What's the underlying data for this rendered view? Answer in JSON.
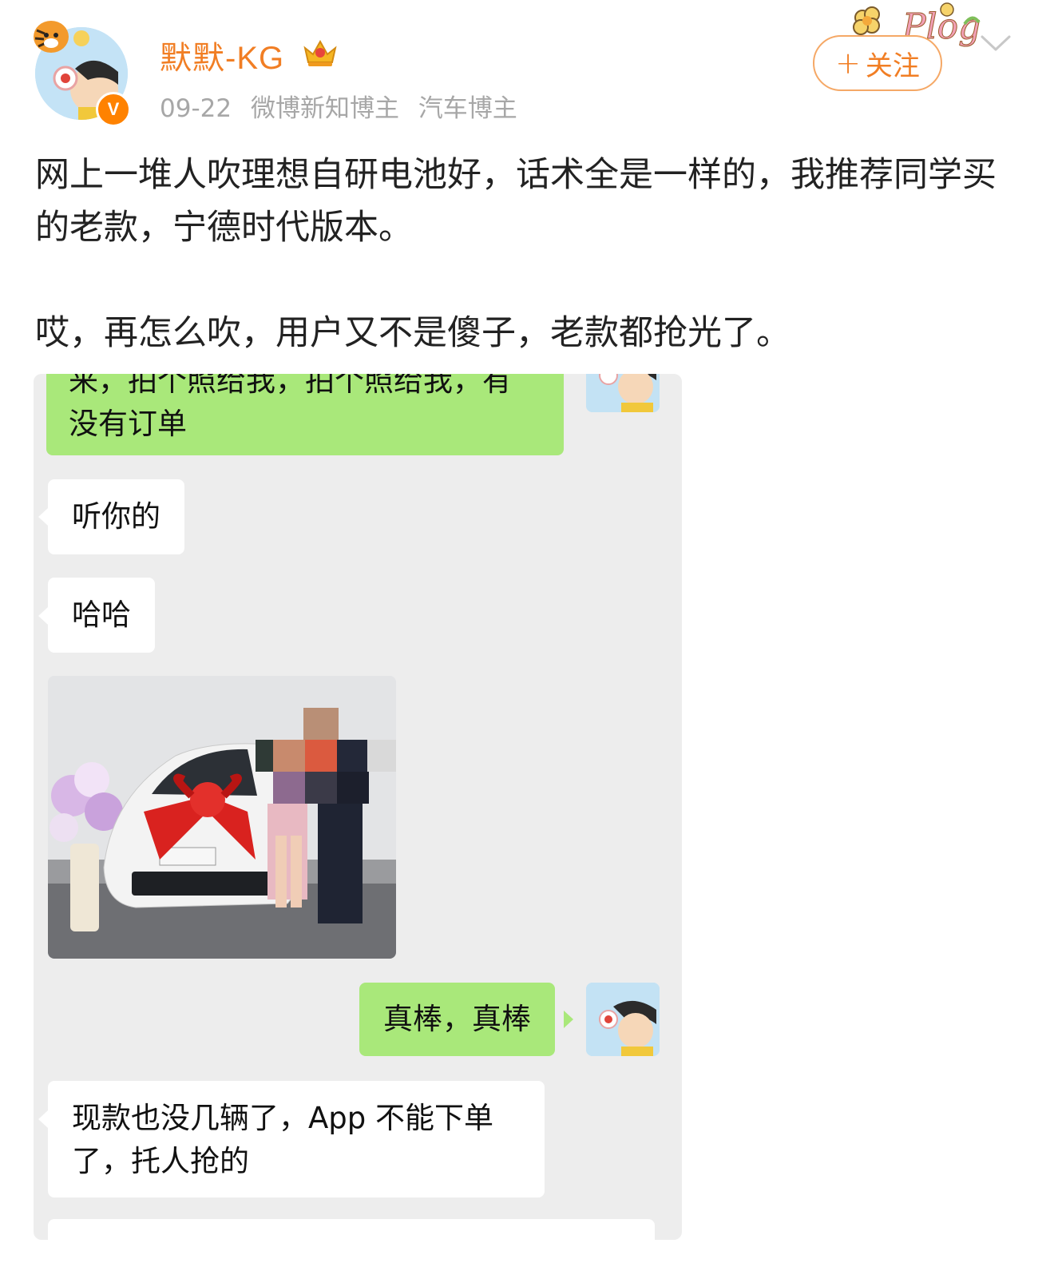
{
  "header": {
    "username": "默默-KG",
    "date": "09-22",
    "tags": [
      "微博新知博主",
      "汽车博主"
    ],
    "follow_label": "关注",
    "plog_label": "Plog",
    "verified_mark": "V"
  },
  "post": {
    "paragraphs": [
      "网上一堆人吹理想自研电池好，话术全是一样的，我推荐同学买的老款，宁德时代版本。",
      "哎，再怎么吹，用户又不是傻子，老款都抢光了。"
    ]
  },
  "chat": {
    "messages": [
      {
        "from": "me",
        "text_top": "来，拍个照给我，拍个照给我，有",
        "text": "没有订单"
      },
      {
        "from": "other",
        "text": "听你的"
      },
      {
        "from": "other",
        "text": "哈哈"
      },
      {
        "from": "other",
        "type": "photo"
      },
      {
        "from": "me",
        "text": "真棒，真棒"
      },
      {
        "from": "other",
        "text": "现款也没几辆了，App 不能下单了，托人抢的"
      }
    ]
  },
  "colors": {
    "accent": "#f17e24",
    "me_bubble": "#a9e87a",
    "chat_bg": "#ededed",
    "meta_gray": "#a7a7a7"
  },
  "icons": [
    "tiger-avatar-frame-icon",
    "verified-badge-icon",
    "crown-icon",
    "plog-sticker-icon",
    "plus-icon",
    "chevron-down-icon"
  ]
}
